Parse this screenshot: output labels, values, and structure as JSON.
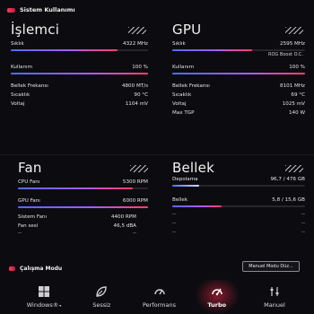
{
  "header": {
    "title": "Sistem Kullanımı"
  },
  "cpu": {
    "title": "İşlemci",
    "rows": [
      {
        "label": "Sıklık",
        "value": "4322 MHz",
        "fill": 0.78
      },
      {
        "label": "Kullanım",
        "value": "100 %",
        "fill": 1.0
      }
    ],
    "stats": [
      {
        "label": "Bellek Frekansı",
        "value": "4800 MT/s"
      },
      {
        "label": "Sıcaklık",
        "value": "90 °C"
      },
      {
        "label": "Voltaj",
        "value": "1104 mV"
      }
    ]
  },
  "gpu": {
    "title": "GPU",
    "rows": [
      {
        "label": "Sıklık",
        "value": "2595 MHz",
        "fill": 0.6
      },
      {
        "label": "Kullanım",
        "value": "100 %",
        "fill": 1.0
      }
    ],
    "boost": "ROG Boost O.C.",
    "stats": [
      {
        "label": "Bellek Frekansı",
        "value": "8101 MHz"
      },
      {
        "label": "Sıcaklık",
        "value": "69 °C"
      },
      {
        "label": "Voltaj",
        "value": "1025 mV"
      },
      {
        "label": "Max TGP",
        "value": "140 W"
      }
    ]
  },
  "fan": {
    "title": "Fan",
    "rows": [
      {
        "label": "CPU Fanı",
        "value": "5300 RPM",
        "fill": 0.88
      },
      {
        "label": "GPU Fanı",
        "value": "6000 RPM",
        "fill": 1.0
      }
    ],
    "stats": [
      {
        "label": "Sistem Fanı",
        "value": "4400 RPM"
      },
      {
        "label": "Fan sesi",
        "value": "46,5 dBA"
      }
    ],
    "dashes": [
      "--",
      "--"
    ]
  },
  "memory": {
    "title": "Bellek",
    "rows": [
      {
        "label": "Depolama",
        "value": "96,7 / 476 GB",
        "fill": 0.2
      },
      {
        "label": "Bellek",
        "value": "5,8 / 15,6 GB",
        "fill": 0.37
      }
    ],
    "dashes": [
      "--",
      "--",
      "--",
      "--"
    ]
  },
  "mode_section": {
    "title": "Çalışma Modu",
    "manual_button": "Manuel Modu Düz...",
    "modes": [
      {
        "label": "Windows®",
        "icon": "windows-icon",
        "active": false
      },
      {
        "label": "Sessiz",
        "icon": "leaf-icon",
        "active": false
      },
      {
        "label": "Performans",
        "icon": "performance-icon",
        "active": false
      },
      {
        "label": "Turbo",
        "icon": "turbo-icon",
        "active": true
      },
      {
        "label": "Manuel",
        "icon": "manual-sliders-icon",
        "active": false
      }
    ]
  },
  "colors": {
    "accent": "#ff3d6a",
    "bar_start": "#4f6cff",
    "bar_mid": "#a85cff"
  }
}
